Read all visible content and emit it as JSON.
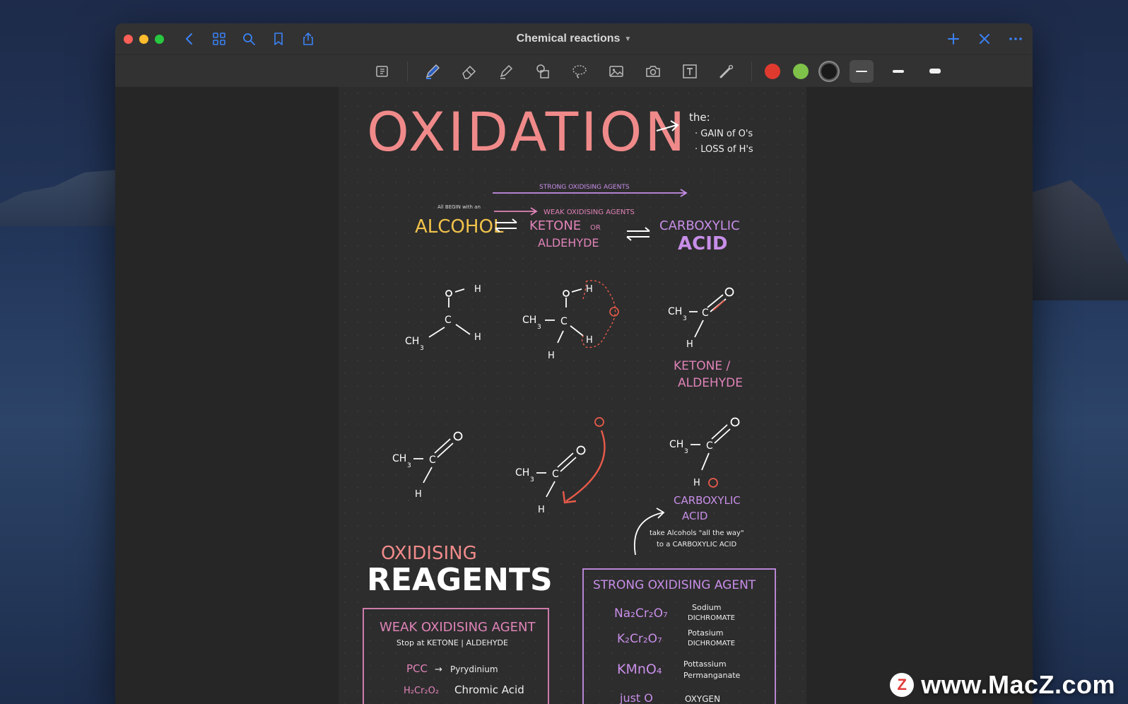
{
  "window": {
    "title": "Chemical reactions"
  },
  "toolbar": {
    "tools": [
      "page-icon",
      "pen-icon",
      "eraser-icon",
      "highlighter-icon",
      "shapes-icon",
      "lasso-icon",
      "image-icon",
      "camera-icon",
      "text-box-icon",
      "laser-pointer-icon"
    ],
    "colors": [
      "#e03a2f",
      "#7fc24a",
      "#1a1a1a"
    ],
    "selected_color_index": 2,
    "selected_stroke_index": 0
  },
  "note": {
    "title": "OXIDATION",
    "definition_intro": "the:",
    "definition_lines": [
      "· GAIN of O's",
      "· LOSS of H's"
    ],
    "strong_agents_label": "STRONG OXIDISING AGENTS",
    "weak_agents_label": "WEAK OXIDISING AGENTS",
    "begin_note": "All BEGIN with an",
    "alcohol": "ALCOHOL",
    "ketone_line1": "KETONE",
    "ketone_or": "OR",
    "ketone_line2": "ALDEHYDE",
    "carboxylic_line1": "CARBOXYLIC",
    "carboxylic_line2": "ACID",
    "ketone_aldehyde_label_1": "KETONE /",
    "ketone_aldehyde_label_2": "ALDEHYDE",
    "carboxylic_label_1": "CARBOXYLIC",
    "carboxylic_label_2": "ACID",
    "take_note_1": "take Alcohols \"all the way\"",
    "take_note_2": "to a CARBOXYLIC ACID",
    "reagents_small": "OXIDISING",
    "reagents_big": "REAGENTS",
    "weak_box": {
      "title": "WEAK OXIDISING AGENT",
      "subtitle": "Stop at KETONE | ALDEHYDE",
      "items": [
        {
          "formula": "PCC",
          "arrow": "→",
          "name": "Pyrydinium"
        },
        {
          "formula": "H₂Cr₂O₂",
          "arrow": "",
          "name": "Chromic Acid"
        }
      ]
    },
    "strong_box": {
      "title": "STRONG OXIDISING AGENT",
      "items": [
        {
          "formula": "Na₂Cr₂O₇",
          "name1": "Sodium",
          "name2": "DICHROMATE"
        },
        {
          "formula": "K₂Cr₂O₇",
          "name1": "Potasium",
          "name2": "DICHROMATE"
        },
        {
          "formula": "KMnO₄",
          "name1": "Pottassium",
          "name2": "Permanganate"
        },
        {
          "formula": "just O",
          "name1": "OXYGEN",
          "name2": ""
        }
      ]
    }
  },
  "watermark": {
    "logo": "Z",
    "text": "www.MacZ.com"
  }
}
